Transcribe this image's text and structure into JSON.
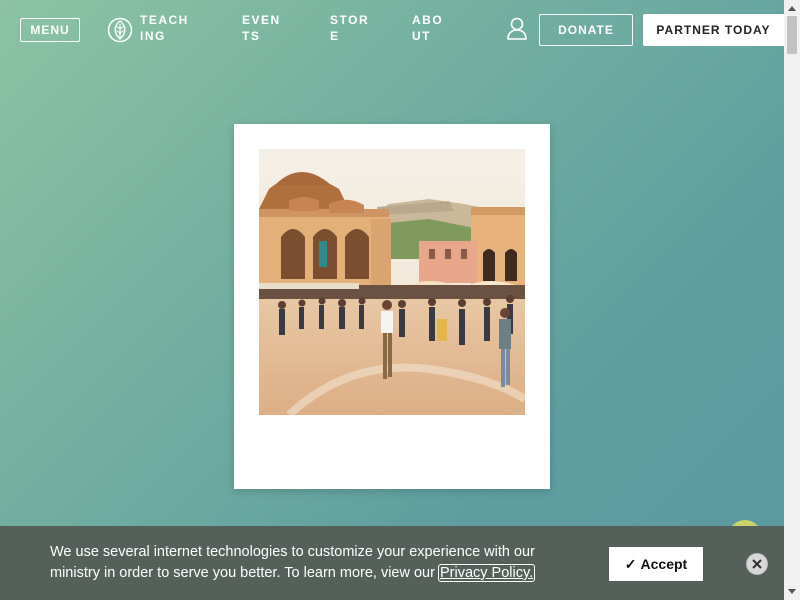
{
  "header": {
    "menu_label": "MENU",
    "nav": [
      "TEACHING",
      "EVENTS",
      "STORE",
      "ABOUT"
    ],
    "donate_label": "DONATE",
    "partner_label": "PARTNER TODAY"
  },
  "hero": {
    "photo_description_icon": "athens-square-photo"
  },
  "cookie": {
    "text": "We use several internet technologies to customize your experience with our ministry in order to serve you better. To learn more, view our ",
    "link_label": "Privacy Policy.",
    "accept_label": "Accept",
    "accept_icon": "check-icon",
    "close_icon": "close-icon"
  },
  "colors": {
    "bg_start": "#8cc3a4",
    "bg_end": "#5a98a0",
    "banner": "#55605a"
  }
}
